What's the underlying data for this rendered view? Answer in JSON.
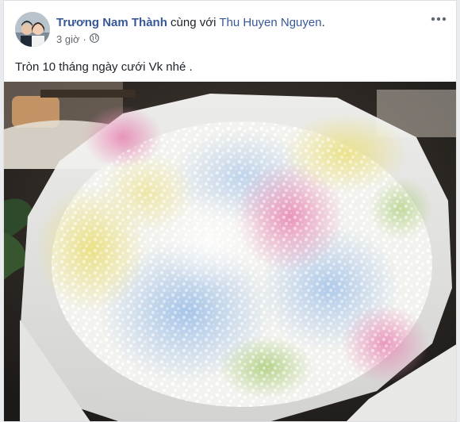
{
  "post": {
    "author": "Trương Nam Thành",
    "with_text": "cùng với",
    "tagged": "Thu Huyen Nguyen",
    "period": ".",
    "time": "3 giờ",
    "audience_icon": "globe-icon",
    "more_icon": "more-options-icon",
    "message": "Tròn 10 tháng ngày cưới Vk nhé ."
  },
  "colors": {
    "link": "#365899",
    "text": "#1d2129",
    "meta": "#616770"
  }
}
